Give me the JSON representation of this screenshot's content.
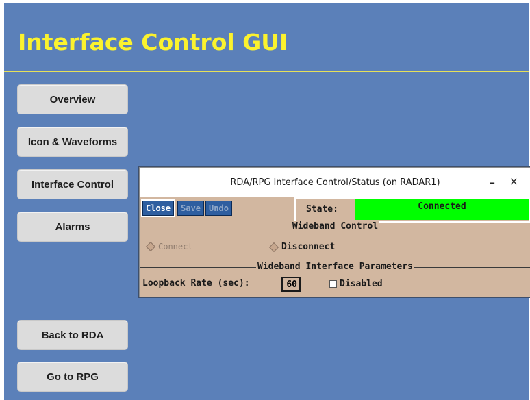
{
  "slide": {
    "title": "Interface Control GUI",
    "nav": [
      {
        "label": "Overview"
      },
      {
        "label": "Icon & Waveforms"
      },
      {
        "label": "Interface Control"
      },
      {
        "label": "Alarms"
      },
      {
        "label": "Back to RDA"
      },
      {
        "label": "Go to RPG"
      }
    ]
  },
  "dialog": {
    "title": "RDA/RPG Interface Control/Status (on RADAR1)",
    "minimize_glyph": "–",
    "close_glyph": "×",
    "buttons": {
      "close": "Close",
      "save": "Save",
      "undo": "Undo"
    },
    "state": {
      "label": "State:",
      "value": "Connected"
    },
    "wideband_control": {
      "title": "Wideband Control",
      "connect": "Connect",
      "disconnect": "Disconnect"
    },
    "wideband_params": {
      "title": "Wideband Interface Parameters",
      "loopback_label": "Loopback Rate (sec):",
      "loopback_value": "60",
      "disabled_label": "Disabled"
    }
  }
}
